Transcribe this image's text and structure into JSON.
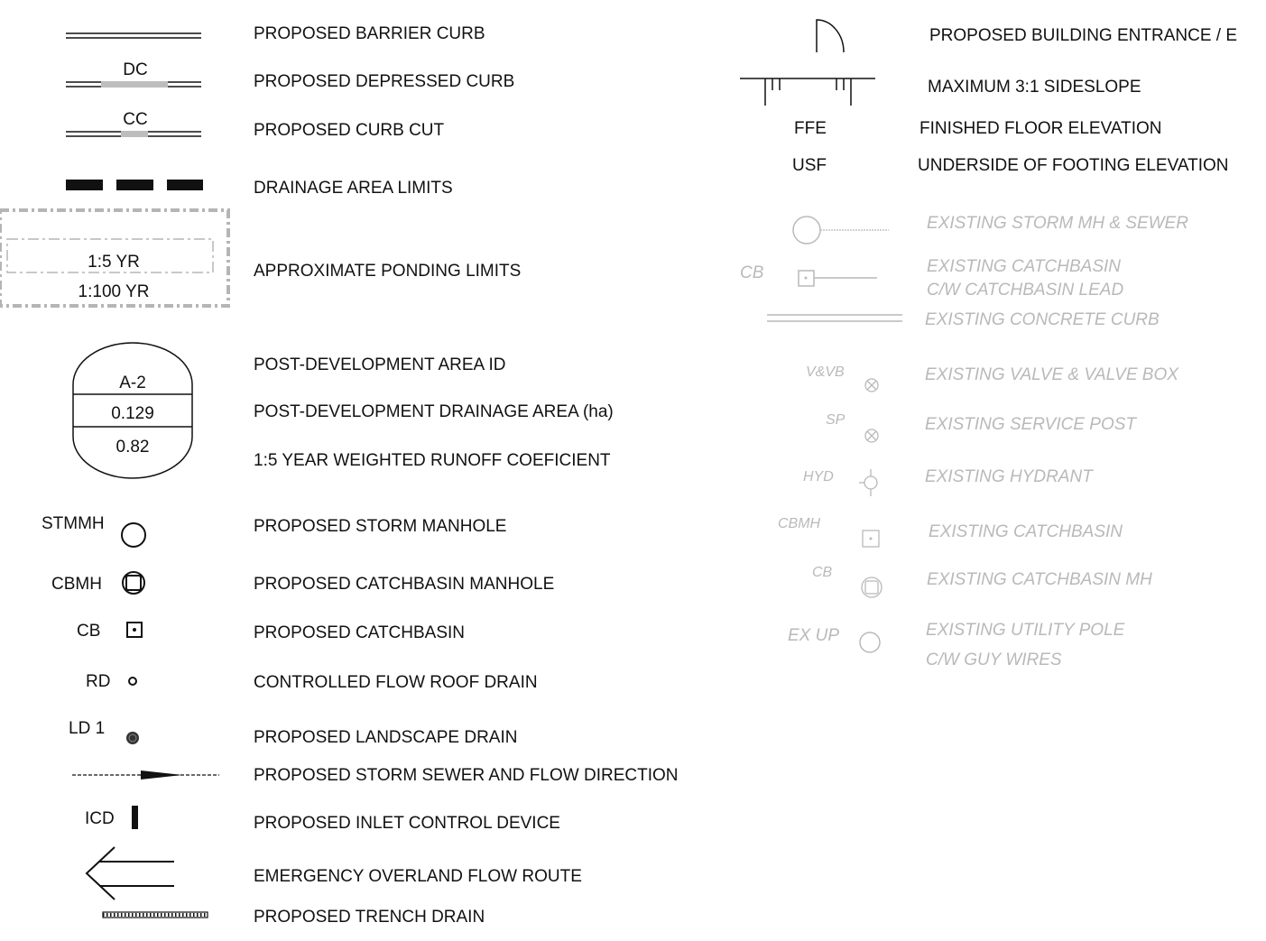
{
  "left_column": [
    {
      "id": "barrier",
      "symbol_text": "",
      "label": "PROPOSED BARRIER CURB"
    },
    {
      "id": "depressed",
      "symbol_text": "DC",
      "label": "PROPOSED DEPRESSED CURB"
    },
    {
      "id": "curbcut",
      "symbol_text": "CC",
      "label": "PROPOSED CURB CUT"
    },
    {
      "id": "drainage",
      "symbol_text": "",
      "label": "DRAINAGE AREA LIMITS"
    },
    {
      "id": "ponding",
      "symbol_text": [
        "1:5 YR",
        "1:100 YR"
      ],
      "label": "APPROXIMATE PONDING LIMITS"
    },
    {
      "id": "areaid",
      "symbol_text": [
        "A-2",
        "0.129",
        "0.82"
      ],
      "labels": [
        "POST-DEVELOPMENT AREA ID",
        "POST-DEVELOPMENT DRAINAGE AREA (ha)",
        "1:5 YEAR WEIGHTED RUNOFF COEFICIENT"
      ]
    },
    {
      "id": "stmmh",
      "symbol_text": "STMMH",
      "label": "PROPOSED STORM MANHOLE"
    },
    {
      "id": "cbmh",
      "symbol_text": "CBMH",
      "label": "PROPOSED CATCHBASIN MANHOLE"
    },
    {
      "id": "cb",
      "symbol_text": "CB",
      "label": "PROPOSED CATCHBASIN"
    },
    {
      "id": "rd",
      "symbol_text": "RD",
      "label": "CONTROLLED FLOW ROOF DRAIN"
    },
    {
      "id": "ld",
      "symbol_text": "LD 1",
      "label": "PROPOSED LANDSCAPE DRAIN"
    },
    {
      "id": "sewer",
      "symbol_text": "",
      "label": "PROPOSED STORM SEWER AND FLOW DIRECTION"
    },
    {
      "id": "icd",
      "symbol_text": "ICD",
      "label": "PROPOSED INLET CONTROL DEVICE"
    },
    {
      "id": "overland",
      "symbol_text": "",
      "label": "EMERGENCY OVERLAND FLOW ROUTE"
    },
    {
      "id": "trench",
      "symbol_text": "",
      "label": "PROPOSED TRENCH DRAIN"
    }
  ],
  "right_column": [
    {
      "id": "entrance",
      "symbol_text": "",
      "label": "PROPOSED BUILDING ENTRANCE / E"
    },
    {
      "id": "sideslope",
      "symbol_text": "",
      "label": "MAXIMUM 3:1 SIDESLOPE"
    },
    {
      "id": "ffe",
      "symbol_text": "FFE",
      "label": "FINISHED FLOOR ELEVATION"
    },
    {
      "id": "usf",
      "symbol_text": "USF",
      "label": "UNDERSIDE OF FOOTING ELEVATION"
    },
    {
      "id": "ex-stm",
      "symbol_text": "",
      "label": "EXISTING STORM MH & SEWER"
    },
    {
      "id": "ex-cb",
      "symbol_text": "CB",
      "label": [
        "EXISTING CATCHBASIN",
        "C/W CATCHBASIN LEAD"
      ]
    },
    {
      "id": "ex-curb",
      "symbol_text": "",
      "label": "EXISTING CONCRETE CURB"
    },
    {
      "id": "ex-valve",
      "symbol_text": "V&VB",
      "label": "EXISTING VALVE & VALVE BOX"
    },
    {
      "id": "ex-sp",
      "symbol_text": "SP",
      "label": "EXISTING SERVICE POST"
    },
    {
      "id": "ex-hyd",
      "symbol_text": "HYD",
      "label": "EXISTING  HYDRANT"
    },
    {
      "id": "ex-cbmh",
      "symbol_text": "CBMH",
      "label": "EXISTING CATCHBASIN"
    },
    {
      "id": "ex-cbmh2",
      "symbol_text": "CB",
      "label": "EXISTING CATCHBASIN MH"
    },
    {
      "id": "ex-pole",
      "symbol_text": "EX UP",
      "label": [
        "EXISTING UTILITY POLE",
        "C/W GUY WIRES"
      ]
    }
  ],
  "colors": {
    "proposed": "#111111",
    "existing": "#b9b9b9",
    "gray_fill": "#bdbdbd"
  }
}
